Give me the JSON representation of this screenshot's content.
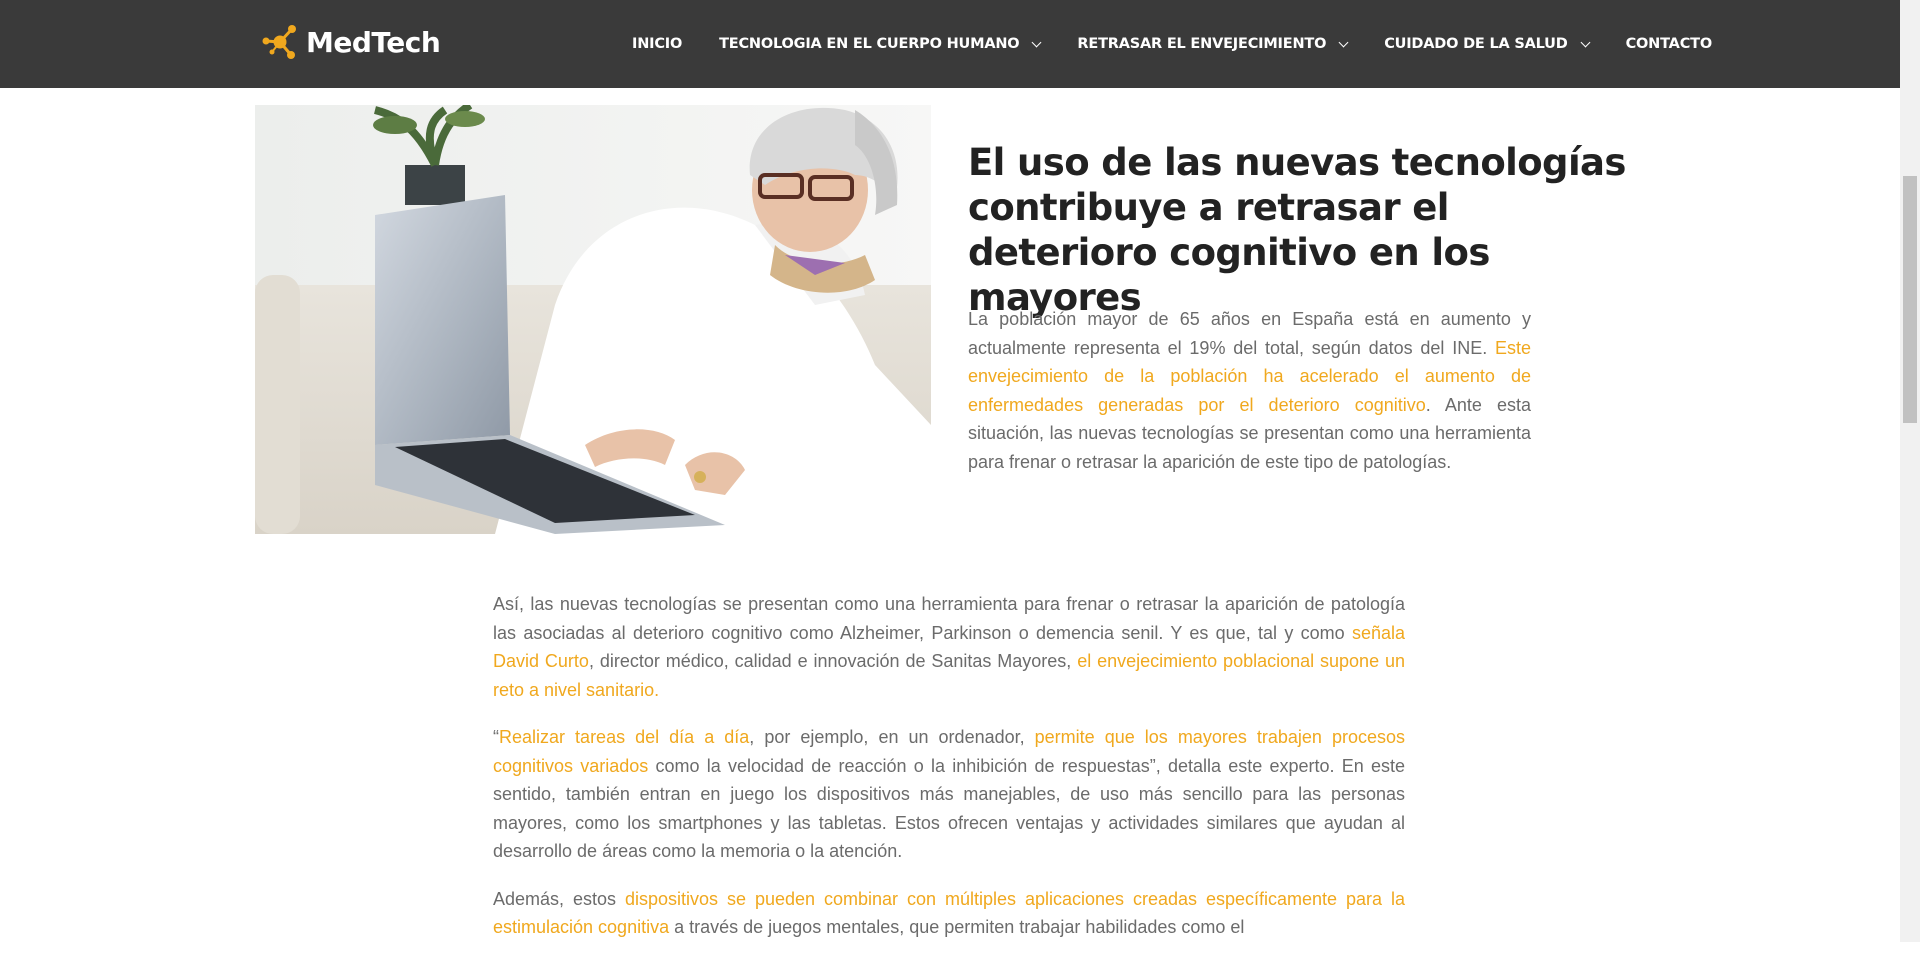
{
  "header": {
    "logo_text": "MedTech",
    "nav": [
      {
        "label": "INICIO",
        "dropdown": false
      },
      {
        "label": "TECNOLOGIA EN EL CUERPO HUMANO",
        "dropdown": true
      },
      {
        "label": "RETRASAR EL ENVEJECIMIENTO",
        "dropdown": true
      },
      {
        "label": "CUIDADO DE LA SALUD",
        "dropdown": true
      },
      {
        "label": "CONTACTO",
        "dropdown": false
      }
    ]
  },
  "article": {
    "title": "El uso de las nuevas tecnologías contribuye a retrasar el deterioro cognitivo en los mayores",
    "intro": {
      "t1": "La población mayor de 65 años en España está en aumento y actualmente representa el 19% del total, según datos del INE. ",
      "h1": "Este envejecimiento de la población ha acelerado el aumento de enfermedades generadas por el deterioro cognitivo",
      "t2": ". Ante esta situación, las nuevas tecnologías se presentan como una herramienta para frenar o retrasar la aparición de este tipo de patologías."
    },
    "p1": {
      "t1": "Así, las nuevas tecnologías se presentan como una herramienta para frenar o retrasar la aparición de patología las asociadas al deterioro cognitivo como Alzheimer, Parkinson o demencia senil. Y es que, tal y como ",
      "h1": "señala David Curto",
      "t2": ", director médico, calidad e innovación de Sanitas Mayores, ",
      "h2": "el envejecimiento poblacional supone un reto a nivel sanitario",
      "t3": "."
    },
    "p2": {
      "t1": "“",
      "h1": "Realizar tareas del día a día",
      "t2": ", por ejemplo, en un ordenador, ",
      "h2": "permite que los mayores trabajen procesos cognitivos variados",
      "t3": " como la velocidad de reacción o la inhibición de respuestas”, detalla este experto. En este sentido, también entran en juego los dispositivos más manejables, de uso más sencillo para las personas mayores, como los smartphones y las tabletas. Estos ofrecen ventajas y actividades similares que ayudan al desarrollo de áreas como la memoria o la atención."
    },
    "p3": {
      "t1": "Además, estos ",
      "h1": "dispositivos se pueden combinar con múltiples aplicaciones creadas específicamente para la estimulación cognitiva",
      "t2": " a través de juegos mentales, que permiten trabajar habilidades como el"
    }
  },
  "colors": {
    "header_bg": "#3a3a3a",
    "accent": "#f0a81e",
    "body_text": "#6b6b6b",
    "title_text": "#222222"
  },
  "icons": {
    "logo": "molecule-icon",
    "dropdown": "chevron-down-icon"
  }
}
